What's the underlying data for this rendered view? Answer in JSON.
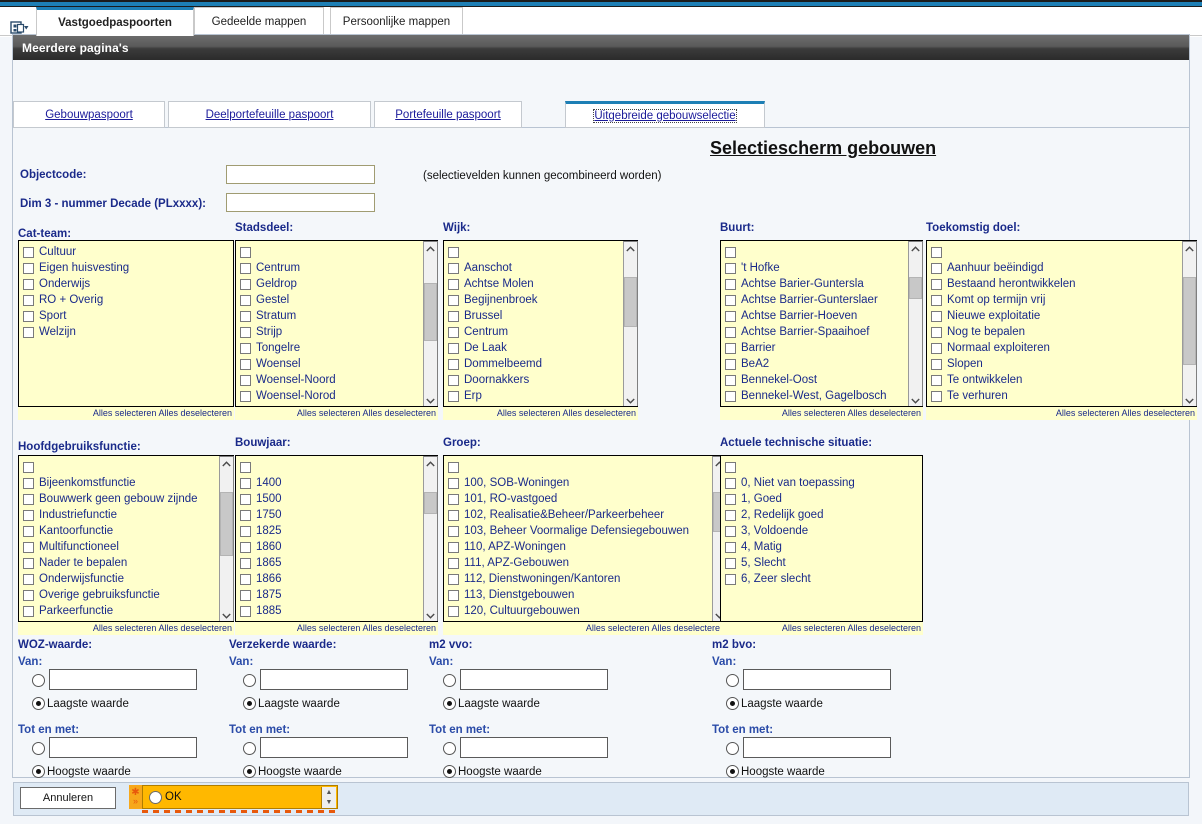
{
  "browser": {
    "tabs": [
      {
        "label": "Vastgoedpaspoorten",
        "active": true
      },
      {
        "label": "Gedeelde mappen",
        "active": false
      },
      {
        "label": "Persoonlijke mappen",
        "active": false
      }
    ]
  },
  "panel": {
    "header_title": "Meerdere pagina's",
    "subtabs": [
      {
        "label": "Gebouwpaspoort",
        "active": false
      },
      {
        "label": "Deelportefeuille paspoort",
        "active": false
      },
      {
        "label": "Portefeuille paspoort",
        "active": false
      },
      {
        "label": "Uitgebreide gebouwselectie",
        "active": true
      }
    ]
  },
  "main": {
    "title": "Selectiescherm gebouwen",
    "note": "(selectievelden kunnen gecombineerd worden)",
    "objectcode_label": "Objectcode:",
    "objectcode_value": "",
    "dim3_label": "Dim 3 - nummer Decade (PLxxxx):",
    "dim3_value": "",
    "select_all_label": "Alles selecteren",
    "deselect_all_label": "Alles deselecteren"
  },
  "lists": {
    "cat_team": {
      "label": "Cat-team:",
      "has_scrollbar": false,
      "blank_first": false,
      "items": [
        "Cultuur",
        "Eigen huisvesting",
        "Onderwijs",
        "RO + Overig",
        "Sport",
        "Welzijn"
      ]
    },
    "stadsdeel": {
      "label": "Stadsdeel:",
      "has_scrollbar": true,
      "blank_first": true,
      "items": [
        "Centrum",
        "Geldrop",
        "Gestel",
        "Stratum",
        "Strijp",
        "Tongelre",
        "Woensel",
        "Woensel-Noord",
        "Woensel-Norod"
      ]
    },
    "wijk": {
      "label": "Wijk:",
      "has_scrollbar": true,
      "blank_first": true,
      "items": [
        "Aanschot",
        "Achtse Molen",
        "Begijnenbroek",
        "Brussel",
        "Centrum",
        "De Laak",
        "Dommelbeemd",
        "Doornakkers",
        "Erp"
      ]
    },
    "buurt": {
      "label": "Buurt:",
      "has_scrollbar": true,
      "blank_first": true,
      "items": [
        "'t Hofke",
        "Achtse Barier-Guntersla",
        "Achtse Barrier-Gunterslaer",
        "Achtse Barrier-Hoeven",
        "Achtse Barrier-Spaaihoef",
        "Barrier",
        "BeA2",
        "Bennekel-Oost",
        "Bennekel-West, Gagelbosch"
      ]
    },
    "toekomstig_doel": {
      "label": "Toekomstig doel:",
      "has_scrollbar": true,
      "blank_first": true,
      "items": [
        "Aanhuur beëindigd",
        "Bestaand herontwikkelen",
        "Komt op termijn vrij",
        "Nieuwe exploitatie",
        "Nog te bepalen",
        "Normaal exploiteren",
        "Slopen",
        "Te ontwikkelen",
        "Te verhuren"
      ]
    },
    "hoofdgebruiksfunctie": {
      "label": "Hoofdgebruiksfunctie:",
      "has_scrollbar": true,
      "blank_first": true,
      "items": [
        "Bijeenkomstfunctie",
        "Bouwwerk geen gebouw zijnde",
        "Industriefunctie",
        "Kantoorfunctie",
        "Multifunctioneel",
        "Nader te bepalen",
        "Onderwijsfunctie",
        "Overige gebruiksfunctie",
        "Parkeerfunctie"
      ]
    },
    "bouwjaar": {
      "label": "Bouwjaar:",
      "has_scrollbar": true,
      "blank_first": true,
      "items": [
        "1400",
        "1500",
        "1750",
        "1825",
        "1860",
        "1865",
        "1866",
        "1875",
        "1885"
      ]
    },
    "groep": {
      "label": "Groep:",
      "has_scrollbar": true,
      "blank_first": true,
      "items": [
        "100, SOB-Woningen",
        "101, RO-vastgoed",
        "102, Realisatie&Beheer/Parkeerbeheer",
        "103, Beheer Voormalige Defensiegebouwen",
        "110, APZ-Woningen",
        "111, APZ-Gebouwen",
        "112, Dienstwoningen/Kantoren",
        "113, Dienstgebouwen",
        "120, Cultuurgebouwen"
      ]
    },
    "actuele_technische_situatie": {
      "label": "Actuele technische situatie:",
      "has_scrollbar": false,
      "blank_first": true,
      "items": [
        "0, Niet van toepassing",
        "1, Goed",
        "2, Redelijk goed",
        "3, Voldoende",
        "4, Matig",
        "5, Slecht",
        "6, Zeer slecht"
      ]
    }
  },
  "ranges": {
    "van_label": "Van:",
    "tot_label": "Tot en met:",
    "laagste_label": "Laagste waarde",
    "hoogste_label": "Hoogste waarde",
    "groups": [
      {
        "label": "WOZ-waarde:",
        "van_value": "",
        "tot_value": "",
        "laagste_checked": true,
        "hoogste_checked": true
      },
      {
        "label": "Verzekerde waarde:",
        "van_value": "",
        "tot_value": "",
        "laagste_checked": true,
        "hoogste_checked": true
      },
      {
        "label": "m2 vvo:",
        "van_value": "",
        "tot_value": "",
        "laagste_checked": true,
        "hoogste_checked": true
      },
      {
        "label": "m2 bvo:",
        "van_value": "",
        "tot_value": "",
        "laagste_checked": true,
        "hoogste_checked": true
      }
    ]
  },
  "footer": {
    "cancel_label": "Annuleren",
    "ok_label": "OK"
  },
  "colors": {
    "accent_blue": "#1d7fb5",
    "list_yellow": "#ffffcc",
    "label_blue": "#1a2a8a",
    "ok_orange": "#ffb800",
    "ok_gutter_orange": "#f7a81b"
  }
}
